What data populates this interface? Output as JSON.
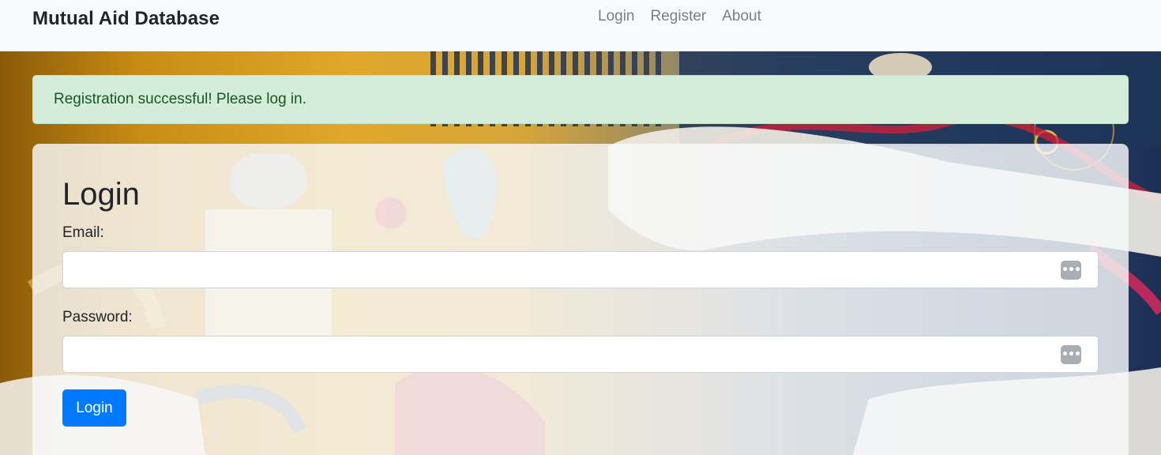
{
  "navbar": {
    "brand": "Mutual Aid Database",
    "links": [
      {
        "label": "Login"
      },
      {
        "label": "Register"
      },
      {
        "label": "About"
      }
    ]
  },
  "alert": {
    "message": "Registration successful! Please log in."
  },
  "login_form": {
    "title": "Login",
    "email_label": "Email:",
    "email_value": "",
    "password_label": "Password:",
    "password_value": "",
    "autofill_icon": "ellipsis-key-icon",
    "submit_label": "Login"
  },
  "colors": {
    "primary": "#007bff",
    "alert_bg": "#d4eddb",
    "alert_text": "#155724",
    "navbar_bg": "#f8f9fa"
  }
}
